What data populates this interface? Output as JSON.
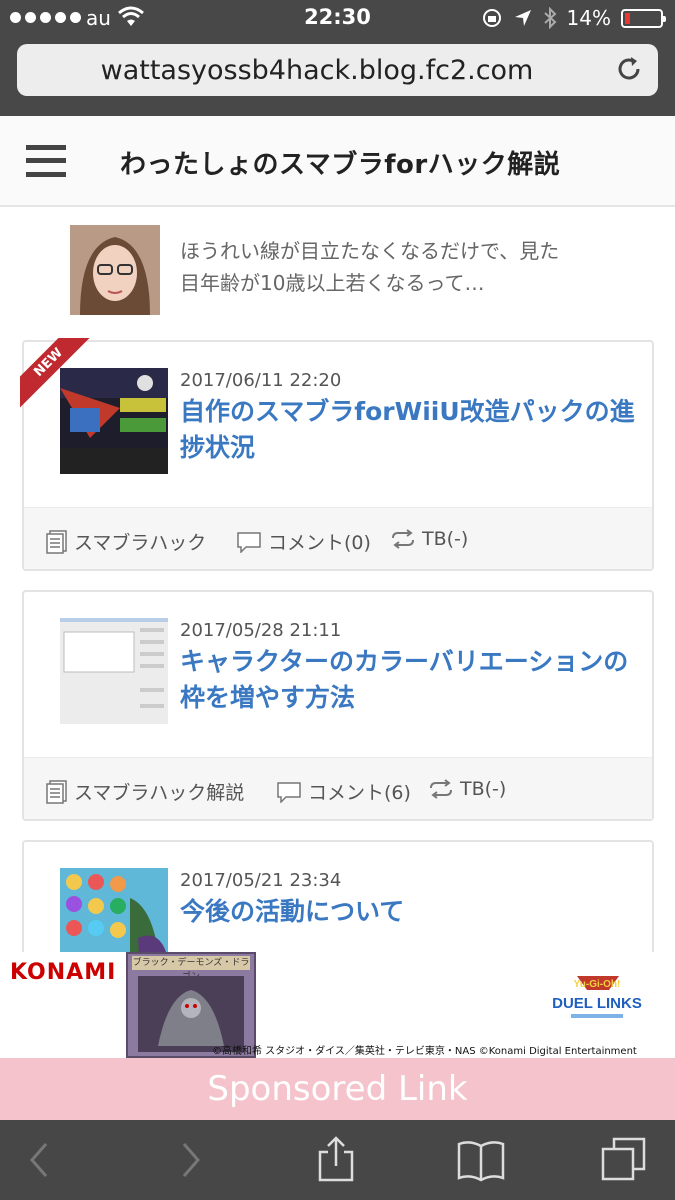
{
  "status_bar": {
    "carrier": "au",
    "time": "22:30",
    "battery": "14%"
  },
  "browser": {
    "url": "wattasyossb4hack.blog.fc2.com"
  },
  "site": {
    "title": "わったしょのスマブラforハック解説"
  },
  "ad": {
    "line1": "ほうれい線が目立たなくなるだけで、見た",
    "line2": "目年齢が10歳以上若くなるって…"
  },
  "posts": [
    {
      "badge": "NEW",
      "date": "2017/06/11  22:20",
      "title": "自作のスマブラforWiiU改造パックの進捗状況",
      "category": "スマブラハック",
      "comments": "コメント(0)",
      "trackback": "TB(-)"
    },
    {
      "date": "2017/05/28  21:11",
      "title": "キャラクターのカラーバリエーションの枠を増やす方法",
      "category": "スマブラハック解説",
      "comments": "コメント(6)",
      "trackback": "TB(-)"
    },
    {
      "date": "2017/05/21  23:34",
      "title": "今後の活動について"
    }
  ],
  "banner": {
    "brand": "KONAMI",
    "card_name": "ブラック・デーモンズ・ドラゴン",
    "game": "DUEL LINKS",
    "copyright": "©高橋和希 スタジオ・ダイス／集英社・テレビ東京・NAS   ©Konami Digital Entertainment"
  },
  "sponsored_label": "Sponsored Link",
  "colors": {
    "link": "#3a78c2",
    "sponsored_bg": "#f4c3cc",
    "new_badge": "#c0292f"
  }
}
